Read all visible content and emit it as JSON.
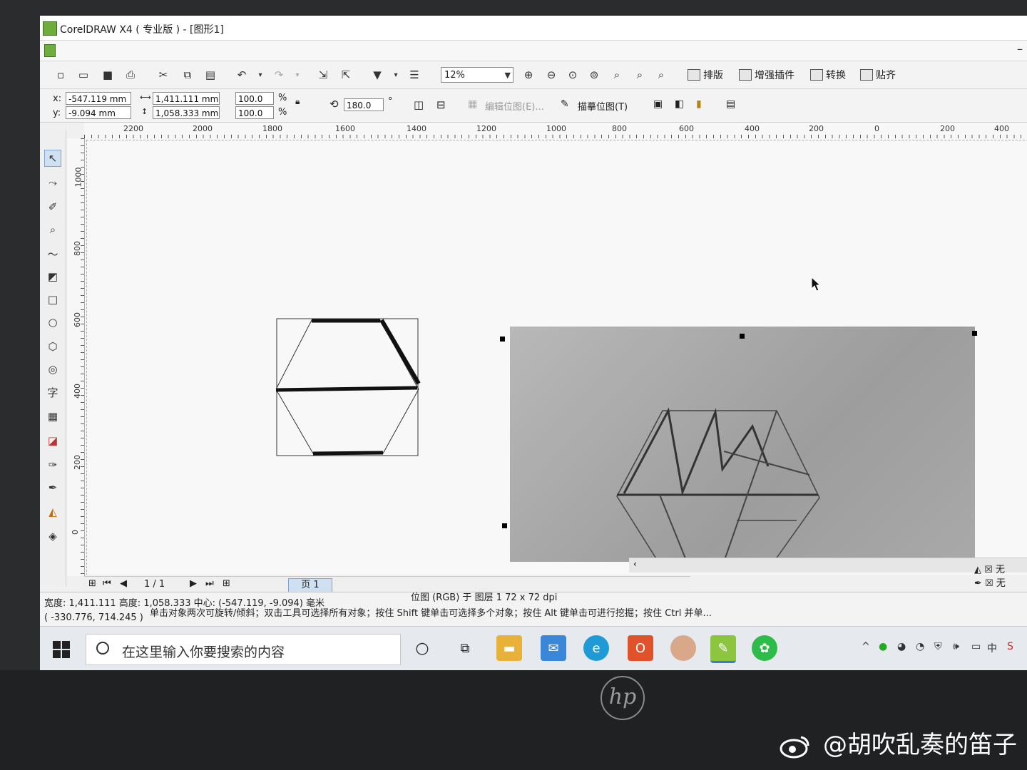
{
  "window": {
    "title": "CorelDRAW X4 ( 专业版 ) - [图形1]"
  },
  "toolbar": {
    "zoom_value": "12%",
    "buttons": {
      "layout_label": "排版",
      "plugins_label": "增强插件",
      "convert_label": "转换",
      "snap_label": "贴齐"
    }
  },
  "property_bar": {
    "x_label": "x:",
    "y_label": "y:",
    "x_value": "-547.119 mm",
    "y_value": "-9.094 mm",
    "width_value": "1,411.111 mm",
    "height_value": "1,058.333 mm",
    "scale_x": "100.0",
    "scale_y": "100.0",
    "percent_sign": "%",
    "rotation": "180.0",
    "degree_sign": "°",
    "edit_bitmap": "编辑位图(E)...",
    "trace_bitmap": "描摹位图(T)"
  },
  "rulers": {
    "horizontal_ticks": [
      "2200",
      "2000",
      "1800",
      "1600",
      "1400",
      "1200",
      "1000",
      "800",
      "600",
      "400",
      "200",
      "0",
      "200",
      "400"
    ],
    "vertical_ticks": [
      "1000",
      "800",
      "600",
      "400",
      "200",
      "0"
    ]
  },
  "page_nav": {
    "page_count": "1 / 1",
    "page_tab": "页 1"
  },
  "fill_indicator": {
    "fill_label": "无",
    "outline_label": "无"
  },
  "status": {
    "dimensions": "宽度: 1,411.111 高度: 1,058.333 中心: (-547.119, -9.094) 毫米",
    "object_info": "位图 (RGB) 于 图层 1 72 x 72 dpi",
    "cursor_pos": "( -330.776, 714.245 )",
    "hint": "单击对象两次可旋转/倾斜；双击工具可选择所有对象；按住 Shift 键单击可选择多个对象；按住 Alt 键单击可进行挖掘；按住 Ctrl 并单..."
  },
  "taskbar": {
    "search_placeholder": "在这里输入你要搜索的内容",
    "ime": "中"
  },
  "watermark": {
    "text": "@胡吹乱奏的笛子"
  }
}
